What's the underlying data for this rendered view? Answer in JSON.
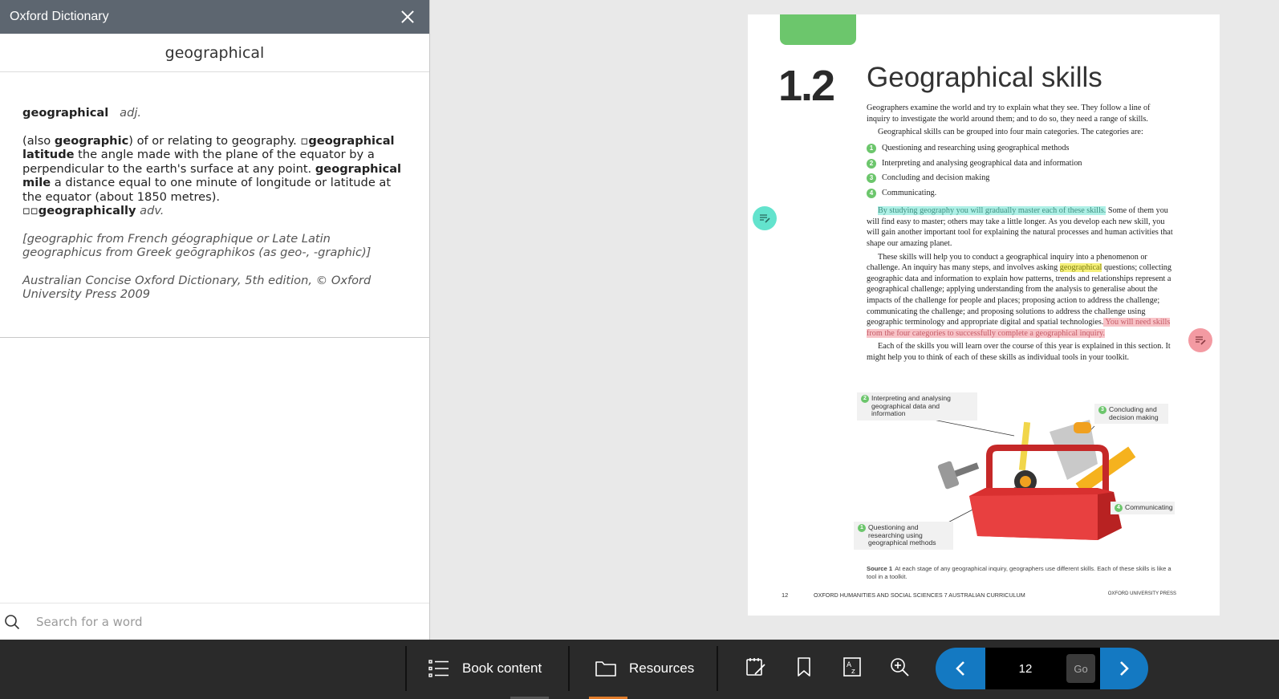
{
  "dictionary": {
    "title": "Oxford Dictionary",
    "word": "geographical",
    "entry": {
      "headword": "geographical",
      "pos": "adj.",
      "also_prefix": "(also ",
      "also_word": "geographic",
      "def_start": ") of or relating to geography. ",
      "sub1_marker": "▫",
      "sub1_term": "geographical latitude",
      "sub1_def": " the angle made with the plane of the equator by a perpendicular to the earth's surface at any point. ",
      "sub2_term": "geographical mile",
      "sub2_def": " a distance equal to one minute of longitude or latitude at the equator (about 1850 metres).",
      "deriv_marker": "▫▫",
      "deriv_term": "geographically",
      "deriv_pos": "adv.",
      "etymology": "[geographic from French géographique or Late Latin geographicus from Greek geōgraphikos (as geo-, -graphic)]",
      "source": "Australian Concise Oxford Dictionary, 5th edition, © Oxford University Press 2009"
    },
    "search_placeholder": "Search for a word"
  },
  "book": {
    "section_number": "1.2",
    "section_title": "Geographical skills",
    "intro": "Geographers examine the world and try to explain what they see. They follow a line of inquiry to investigate the world around them; and to do so, they need a range of skills.",
    "categories_lead": "Geographical skills can be grouped into four main categories. The categories are:",
    "skills": [
      {
        "n": "1",
        "label": "Questioning and researching using geographical methods"
      },
      {
        "n": "2",
        "label": "Interpreting and analysing geographical data and information"
      },
      {
        "n": "3",
        "label": "Concluding and decision making"
      },
      {
        "n": "4",
        "label": "Communicating."
      }
    ],
    "p3_highlight": "By studying geography you will gradually master each of these skills.",
    "p3_rest": " Some of them you will find easy to master; others may take a little longer. As you develop each new skill, you will gain another important tool for explaining the natural processes and human activities that shape our amazing planet.",
    "p4_a": "These skills will help you to conduct a geographical inquiry into a phenomenon or challenge. An inquiry has many steps, and involves asking ",
    "p4_highlight": "geographical",
    "p4_b": " questions; collecting geographic data and information to explain how patterns, trends and relationships represent a geographical challenge; applying understanding from the analysis to generalise about the impacts of the challenge for people and places; proposing action to address the challenge; communicating the challenge; and proposing solutions to address the challenge using geographic terminology and appropriate digital and spatial technologies.",
    "p4_pink": " You will need skills from the four categories to successfully complete a geographical inquiry.",
    "p5": "Each of the skills you will learn over the course of this year is explained in this section. It might help you to think of each of these skills as individual tools in your toolkit.",
    "callouts": [
      {
        "n": "2",
        "text": "Interpreting and analysing geographical data and information"
      },
      {
        "n": "3",
        "text": "Concluding and decision making"
      },
      {
        "n": "4",
        "text": "Communicating"
      },
      {
        "n": "1",
        "text": "Questioning and researching using geographical methods"
      }
    ],
    "caption_label": "Source 1",
    "caption_text": "At each stage of any geographical inquiry, geographers use different skills. Each of these skills is like a tool in a toolkit.",
    "footer_page": "12",
    "footer_title": "OXFORD HUMANITIES AND SOCIAL SCIENCES 7  AUSTRALIAN CURRICULUM",
    "footer_press": "OXFORD UNIVERSITY PRESS"
  },
  "toolbar": {
    "book_content": "Book content",
    "resources": "Resources",
    "page_value": "12",
    "go_label": "Go"
  },
  "colors": {
    "accent_blue": "#1479c2",
    "green": "#6cc66c",
    "teal_note": "#63e3cd",
    "pink_note": "#f39aa2",
    "resources_indicator": "#e07b2a"
  }
}
